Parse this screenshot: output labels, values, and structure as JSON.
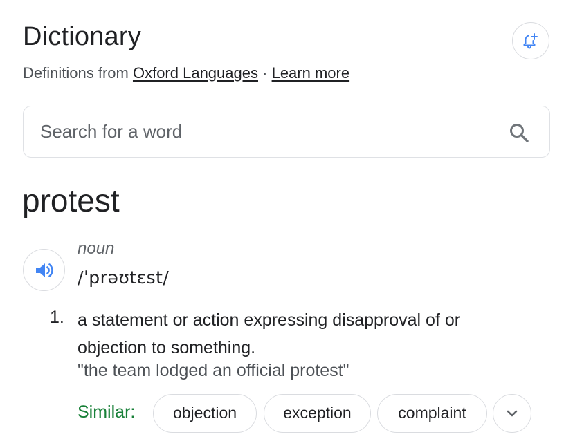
{
  "header": {
    "title": "Dictionary",
    "subtitle_prefix": "Definitions from",
    "source_link": "Oxford Languages",
    "separator": "·",
    "learn_more": "Learn more",
    "alert_icon": "add-alert-bell-icon"
  },
  "search": {
    "placeholder": "Search for a word",
    "value": "",
    "icon": "search-icon"
  },
  "entry": {
    "word": "protest",
    "part_of_speech": "noun",
    "pronunciation": "/ˈprəʊtɛst/",
    "audio_icon": "speaker-icon",
    "definitions": [
      {
        "number": "1.",
        "text": "a statement or action expressing disapproval of or objection to something.",
        "example": "\"the team lodged an official protest\""
      }
    ],
    "similar": {
      "label": "Similar:",
      "words": [
        "objection",
        "exception",
        "complaint"
      ],
      "expand_icon": "chevron-down-icon"
    }
  },
  "colors": {
    "link_blue": "#4285f4",
    "similar_green": "#188038",
    "text": "#202124",
    "secondary_text": "#5f6368",
    "border": "#dadce0"
  }
}
